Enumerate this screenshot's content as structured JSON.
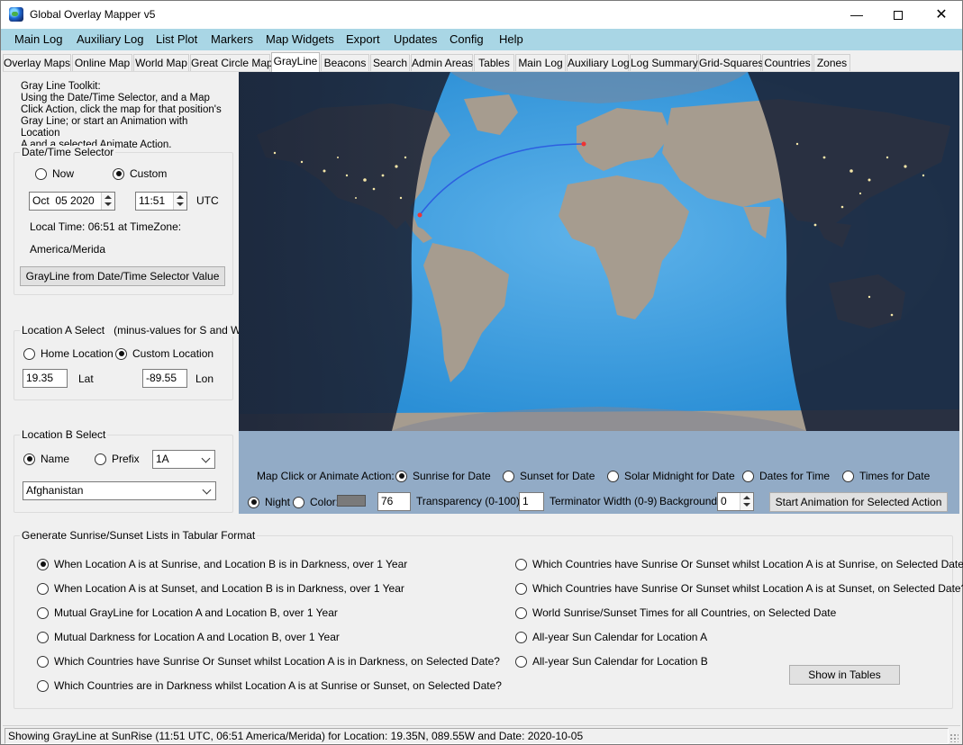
{
  "window": {
    "title": "Global Overlay Mapper v5"
  },
  "menu": [
    "Main Log",
    "Auxiliary Log",
    "List Plot",
    "Markers",
    "Map Widgets",
    "Export",
    "Updates",
    "Config",
    "Help"
  ],
  "tabs": [
    "Overlay Maps",
    "Online Map",
    "World Map",
    "Great Circle Map",
    "GrayLine",
    "Beacons",
    "Search",
    "Admin Areas",
    "Tables",
    "Main Log",
    "Auxiliary Log",
    "Log Summary",
    "Grid-Squares",
    "Countries",
    "Zones"
  ],
  "active_tab": "GrayLine",
  "toolkit": {
    "title": "Gray Line Toolkit:",
    "lines": [
      "Using the Date/Time Selector, and a Map",
      "Click Action, click the map for that position's",
      "Gray Line; or start an Animation with Location",
      "A and a selected Animate Action."
    ]
  },
  "datetime": {
    "legend": "Date/Time Selector",
    "now_label": "Now",
    "custom_label": "Custom",
    "selected": "custom",
    "date_value": "Oct  05 2020",
    "time_value": "11:51",
    "utc_label": "UTC",
    "local_time": "Local Time: 06:51 at TimeZone:",
    "timezone": "America/Merida",
    "button_label": "GrayLine from Date/Time Selector Value"
  },
  "location_a": {
    "legend": "Location A Select   (minus-values for S and W)",
    "home_label": "Home Location",
    "custom_label": "Custom Location",
    "selected": "custom",
    "lat_value": "19.35",
    "lat_label": "Lat",
    "lon_value": "-89.55",
    "lon_label": "Lon"
  },
  "location_b": {
    "legend": "Location B Select",
    "name_label": "Name",
    "prefix_label": "Prefix",
    "selected": "name",
    "prefix_value": "1A",
    "country_value": "Afghanistan"
  },
  "map_actions": {
    "label": "Map Click or Animate Action:",
    "options": [
      "Sunrise for Date",
      "Sunset for Date",
      "Solar Midnight for Date",
      "Dates for Time",
      "Times for Date"
    ],
    "selected_index": 0
  },
  "display": {
    "night_label": "Night",
    "color_label": "Color:",
    "mode": "night",
    "swatch_color": "#7a7a7a",
    "transparency_value": "76",
    "transparency_label": "Transparency (0-100)",
    "terminator_value": "1",
    "terminator_label": "Terminator Width (0-9)",
    "background_label": "Background:",
    "background_value": "0",
    "animate_button": "Start Animation for Selected Action"
  },
  "lists": {
    "legend": "Generate Sunrise/Sunset Lists in Tabular Format",
    "left_options": [
      "When Location A is at Sunrise, and Location B is in Darkness, over 1 Year",
      "When Location A is at Sunset, and Location B is in Darkness, over 1 Year",
      "Mutual GrayLine for Location A and Location B, over 1 Year",
      "Mutual Darkness for Location A and Location B, over 1 Year",
      "Which Countries have Sunrise Or Sunset whilst Location A is in Darkness, on Selected Date?",
      "Which Countries are in Darkness whilst Location A is at Sunrise or Sunset, on Selected Date?"
    ],
    "right_options": [
      "Which Countries have Sunrise Or Sunset whilst Location A is at Sunrise, on Selected Date?",
      "Which Countries have Sunrise Or Sunset whilst Location A is at Sunset, on Selected Date?",
      "World Sunrise/Sunset Times for all Countries, on Selected Date",
      "All-year Sun Calendar for Location A",
      "All-year Sun Calendar for Location B"
    ],
    "selected": "left-0",
    "show_button": "Show in Tables"
  },
  "status": "Showing GrayLine at SunRise (11:51 UTC, 06:51 America/Merida) for Location: 19.35N, 089.55W and Date: 2020-10-05",
  "colors": {
    "menu_bg": "#a9d6e5",
    "ocean": "#2b8fd6",
    "land": "#a69c8f",
    "night": "#1c2538",
    "controls_bg": "#92abc6"
  }
}
